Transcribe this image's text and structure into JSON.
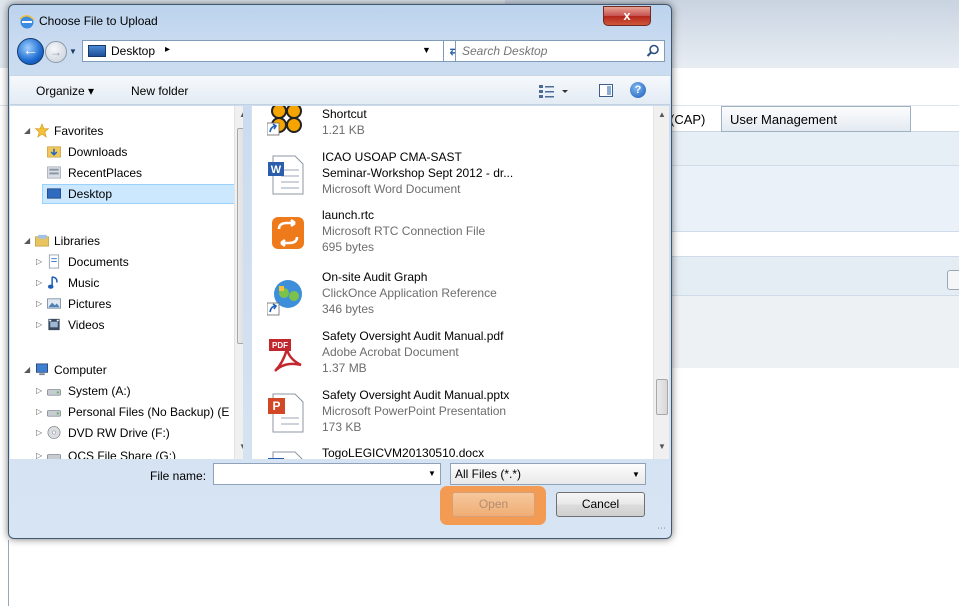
{
  "background_page": {
    "menu_partial": "(CAP)",
    "menu_user_management": "User Management"
  },
  "dialog": {
    "title": "Choose File to Upload",
    "close_label": "x",
    "address": {
      "location": "Desktop",
      "separator": "▸"
    },
    "search": {
      "placeholder": "Search Desktop"
    },
    "toolbar": {
      "organize": "Organize ▾",
      "new_folder": "New folder",
      "help": "?"
    },
    "nav": {
      "favorites": "Favorites",
      "downloads": "Downloads",
      "recent_places": "RecentPlaces",
      "desktop": "Desktop",
      "libraries": "Libraries",
      "documents": "Documents",
      "music": "Music",
      "pictures": "Pictures",
      "videos": "Videos",
      "computer": "Computer",
      "system_a": "System (A:)",
      "personal_files": "Personal Files (No Backup) (E",
      "dvd_drive": "DVD RW Drive (F:)",
      "partial_drive": "OCS File Share (G:)"
    },
    "files": [
      {
        "name": "Shortcut",
        "type": "",
        "size": "1.21 KB",
        "icon": "shortcut-icon"
      },
      {
        "name": "ICAO USOAP CMA-SAST",
        "type": "Seminar-Workshop Sept 2012 - dr...",
        "size": "Microsoft Word Document",
        "icon": "word-document-icon"
      },
      {
        "name": "launch.rtc",
        "type": "Microsoft RTC Connection File",
        "size": "695 bytes",
        "icon": "rtc-connection-icon"
      },
      {
        "name": "On-site Audit Graph",
        "type": "ClickOnce Application Reference",
        "size": "346 bytes",
        "icon": "clickonce-app-icon"
      },
      {
        "name": "Safety Oversight Audit Manual.pdf",
        "type": "Adobe Acrobat Document",
        "size": "1.37 MB",
        "icon": "pdf-icon"
      },
      {
        "name": "Safety Oversight Audit Manual.pptx",
        "type": "Microsoft PowerPoint Presentation",
        "size": "173 KB",
        "icon": "powerpoint-icon"
      },
      {
        "name": "TogoLEGICVM20130510.docx",
        "type": "",
        "size": "",
        "icon": "word-document-icon"
      }
    ],
    "file_name_label": "File name:",
    "file_name_value": "",
    "filter_value": "All Files (*.*)",
    "open_label": "Open",
    "cancel_label": "Cancel",
    "colors": {
      "highlight": "#f39b53",
      "selection": "#cce8ff"
    }
  }
}
